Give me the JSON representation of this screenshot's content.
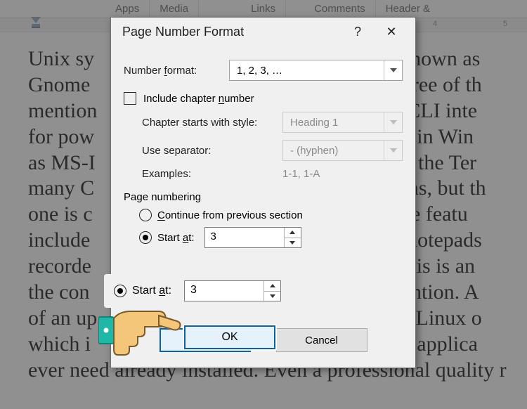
{
  "ribbon": {
    "tabs": [
      "Apps",
      "Media",
      "Links",
      "Comments",
      "Header &"
    ]
  },
  "ruler": {
    "visible_tick": "4"
  },
  "document": {
    "text": "Unix sy                                                    ell, known as\nGnome                                                    All three of th\nmention                                                   lt-in CLI inte\nfor pow                                                   e CLI in Win\nas MS-I                                                   wn as the Ter\nmany C                                                    ystems, but th\none is c                                                   d more featu\ninclude                                                    ding notepads\nrecorde                                                    es. This is an\nthe con                                                    to mention. A\nof an up                                                   n is a Linux o\nwhich i                                                    every applica\never need already installed. Even a professional quality r"
  },
  "dialog": {
    "title": "Page Number Format",
    "help_glyph": "?",
    "close_glyph": "✕",
    "number_format": {
      "label": "Number format:",
      "value": "1, 2, 3, …"
    },
    "include_chapter_label": "Include chapter number",
    "chapter": {
      "style_label": "Chapter starts with style:",
      "style_value": "Heading 1",
      "separator_label": "Use separator:",
      "separator_value": "-  (hyphen)",
      "examples_label": "Examples:",
      "examples_value": "1-1, 1-A"
    },
    "page_numbering": {
      "group_label": "Page numbering",
      "continue_label": "Continue from previous section",
      "start_at_label": "Start at:",
      "start_at_value": "3"
    },
    "buttons": {
      "ok": "OK",
      "cancel": "Cancel"
    }
  }
}
